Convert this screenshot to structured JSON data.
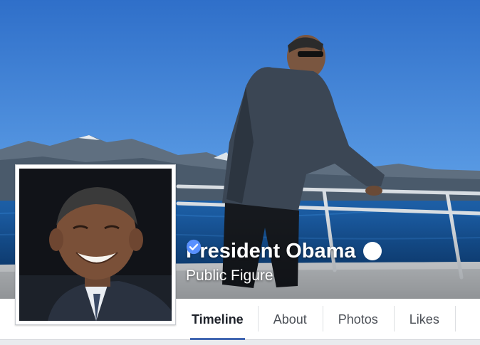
{
  "page": {
    "name": "President Obama",
    "category": "Public Figure",
    "verified_icon": "verified-checkmark-icon"
  },
  "nav": {
    "tabs": [
      {
        "label": "Timeline",
        "active": true
      },
      {
        "label": "About",
        "active": false
      },
      {
        "label": "Photos",
        "active": false
      },
      {
        "label": "Likes",
        "active": false
      }
    ]
  },
  "colors": {
    "sky": "#3f86d8",
    "accent": "#4267b2",
    "verified": "#5890ff"
  }
}
